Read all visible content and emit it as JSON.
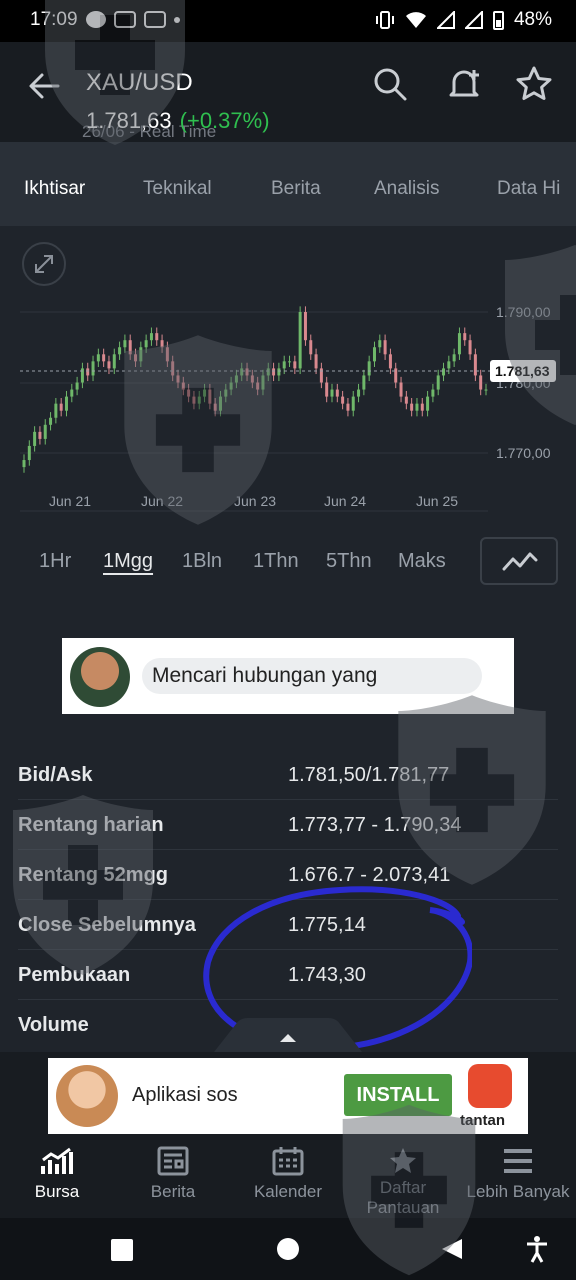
{
  "status_bar": {
    "time": "17:09",
    "battery": "48%"
  },
  "header": {
    "symbol": "XAU/USD",
    "price": "1.781,63",
    "change": "(+0.37%)",
    "realtime": "26/06 - Real Time"
  },
  "tabs": [
    "Ikhtisar",
    "Teknikal",
    "Berita",
    "Analisis",
    "Data Hi"
  ],
  "chart_data": {
    "type": "candlestick",
    "x_labels": [
      "Jun 21",
      "Jun 22",
      "Jun 23",
      "Jun 24",
      "Jun 25"
    ],
    "y_labels": [
      "1.790,00",
      "1.780,00",
      "1.770,00"
    ],
    "y_ticks": [
      1790,
      1780,
      1770
    ],
    "ylim": [
      1765,
      1792.5
    ],
    "current_value": 1781.63,
    "current_label": "1.781,63",
    "close_series": [
      1769,
      1771,
      1773,
      1772,
      1774,
      1775,
      1777,
      1776,
      1778,
      1779,
      1780,
      1782,
      1781,
      1783,
      1784,
      1783,
      1782,
      1784,
      1785,
      1786,
      1784,
      1783,
      1785,
      1786,
      1787,
      1786,
      1785,
      1783,
      1781,
      1780,
      1779,
      1778,
      1777,
      1778,
      1779,
      1777,
      1776,
      1778,
      1779,
      1780,
      1781,
      1782,
      1781,
      1780,
      1779,
      1781,
      1782,
      1781,
      1782,
      1783,
      1783,
      1782,
      1790,
      1786,
      1784,
      1782,
      1780,
      1778,
      1779,
      1778,
      1777,
      1776,
      1778,
      1779,
      1781,
      1783,
      1785,
      1786,
      1784,
      1782,
      1780,
      1778,
      1777,
      1776,
      1777,
      1776,
      1778,
      1779,
      1781,
      1782,
      1783,
      1784,
      1787,
      1786,
      1784,
      1781,
      1779,
      1779
    ]
  },
  "periods": [
    "1Hr",
    "1Mgg",
    "1Bln",
    "1Thn",
    "5Thn",
    "Maks"
  ],
  "ad1": {
    "text": "Mencari hubungan yang"
  },
  "stats": [
    {
      "label": "Bid/Ask",
      "value": "1.781,50/1.781,77"
    },
    {
      "label": "Rentang harian",
      "value": "1.773,77 - 1.790,34"
    },
    {
      "label": "Rentang 52mgg",
      "value": "1.676.7 - 2.073,41"
    },
    {
      "label": "Close Sebelumnya",
      "value": "1.775,14"
    },
    {
      "label": "Pembukaan",
      "value": "1.743,30"
    },
    {
      "label": "Volume",
      "value": ""
    }
  ],
  "ad2": {
    "text": "Aplikasi sos",
    "install": "INSTALL",
    "app_name": "tantan"
  },
  "bottom_nav": [
    "Bursa",
    "Berita",
    "Kalender",
    "Daftar Pantauan",
    "Lebih Banyak"
  ],
  "colors": {
    "up": "#6fb86a",
    "down": "#d9898f",
    "accent_green": "#2fbf4f",
    "annotation": "#2a2ad0"
  }
}
